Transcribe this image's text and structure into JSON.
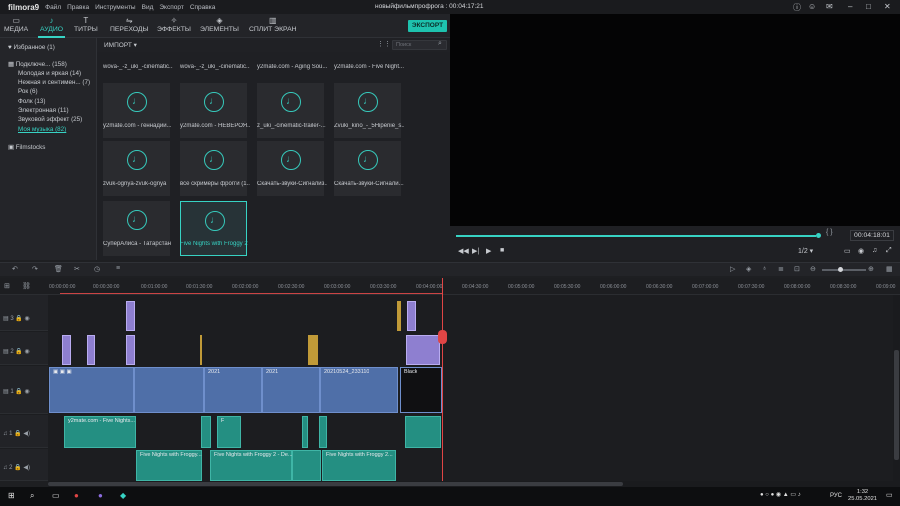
{
  "app": {
    "logo": "filmora9",
    "menu": [
      "Файл",
      "Правка",
      "Инструменты",
      "Вид",
      "Экспорт",
      "Справка"
    ],
    "title": "новыйфильмпрофрога : 00:04:17:21"
  },
  "top_tabs": [
    {
      "icon": "folder-icon",
      "label": "МЕДИА",
      "active": false
    },
    {
      "icon": "music-note-icon",
      "label": "АУДИО",
      "active": true
    },
    {
      "icon": "text-icon",
      "label": "ТИТРЫ",
      "active": false
    },
    {
      "icon": "transition-icon",
      "label": "ПЕРЕХОДЫ",
      "active": false
    },
    {
      "icon": "effects-icon",
      "label": "ЭФФЕКТЫ",
      "active": false
    },
    {
      "icon": "elements-icon",
      "label": "ЭЛЕМЕНТЫ",
      "active": false
    },
    {
      "icon": "splitscreen-icon",
      "label": "СПЛИТ ЭКРАН",
      "active": false
    }
  ],
  "export_label": "ЭКСПОРТ",
  "sidebar": {
    "favorites": "Избранное (1)",
    "items": [
      {
        "label": "Подключе... (158)",
        "sub": false
      },
      {
        "label": "Молодая и яркая (14)",
        "sub": true
      },
      {
        "label": "Нежная и сентимен... (7)",
        "sub": true
      },
      {
        "label": "Рок (6)",
        "sub": true
      },
      {
        "label": "Фолк (13)",
        "sub": true
      },
      {
        "label": "Электронная (11)",
        "sub": true
      },
      {
        "label": "Звуковой эффект (25)",
        "sub": true
      },
      {
        "label": "Моя музыка (82)",
        "sub": true,
        "active": true
      }
    ],
    "filmstocks": "Filmstocks"
  },
  "library": {
    "import_label": "ИМПОРТ",
    "search_placeholder": "Поиск",
    "top_row": [
      "wova-_-z_uki_-cinematic...",
      "wova-_-z_uki_-cinematic...",
      "y2mate.com - Aging Sou...",
      "y2mate.com - Five Night..."
    ],
    "tiles": [
      "y2mate.com - геннадий...",
      "y2mate.com - НЕВЕРОЯ...",
      "z_uki_-cinematic-trailer-...",
      "Zvuki_kino_-_5Hipenie_s...",
      "zvuk-ognya-zvuk-ognya",
      "все скримеры фрогги (1...",
      "Скачать-звуки-Сигнализ...",
      "Скачать-звуки-Сигнали...",
      "СуперАлиса - Татарстан",
      "Five Nights with Froggy 2"
    ],
    "selected_index": 9
  },
  "player": {
    "timecode": "00:04:18:01",
    "ratio": "1/2",
    "progress": 0.98
  },
  "ruler": [
    "00:00:00:00",
    "00:00:30:00",
    "00:01:00:00",
    "00:01:30:00",
    "00:02:00:00",
    "00:02:30:00",
    "00:03:00:00",
    "00:03:30:00",
    "00:04:00:00",
    "00:04:30:00",
    "00:05:00:00",
    "00:05:30:00",
    "00:06:00:00",
    "00:06:30:00",
    "00:07:00:00",
    "00:07:30:00",
    "00:08:00:00",
    "00:08:30:00",
    "00:09:00"
  ],
  "tracks": {
    "v3": "3",
    "v2": "2",
    "v1": "1",
    "a1": "1",
    "a2": "2"
  },
  "clips": {
    "v1_clip_a": "2021",
    "v1_clip_b": "20210524_233110",
    "v1_black": "Black",
    "a1_clip_a": "y2mate.com - Five Nights...",
    "a1_clip_b": "F",
    "a2_clip_a": "Five Nights with Froggy...",
    "a2_clip_b": "Five Nights with Froggy 2 - De...",
    "a2_clip_c": "Five Nights with Froggy 2..."
  },
  "taskbar": {
    "lang": "РУС",
    "time": "1:32",
    "date": "25.05.2021"
  },
  "colors": {
    "accent": "#37d3c4",
    "video_clip": "#4f6fa8",
    "audio_clip": "#248f82",
    "title_clip": "#8e7fd0",
    "playhead": "#e04545"
  }
}
